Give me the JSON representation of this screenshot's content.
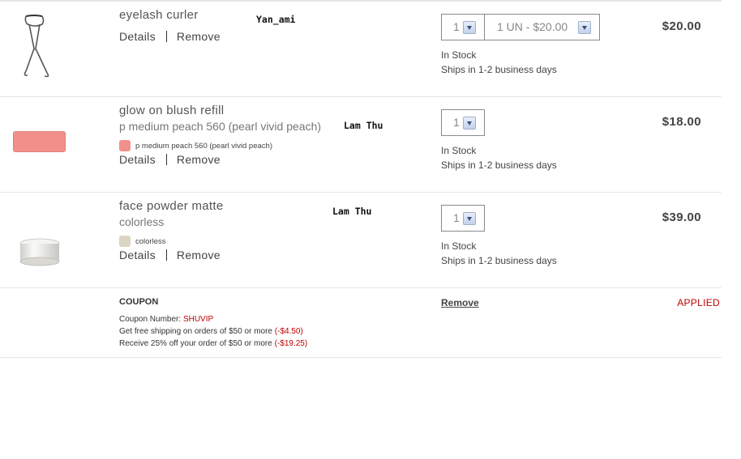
{
  "items": [
    {
      "name": "eyelash curler",
      "details_label": "Details",
      "remove_label": "Remove",
      "user_tag": "Yan_ami",
      "qty": "1",
      "variant": "1 UN - $20.00",
      "stock": "In Stock",
      "ships": "Ships in 1-2 business days",
      "price": "$20.00",
      "icon": "eyelash-curler-icon"
    },
    {
      "name": "glow on blush refill",
      "shade": "p medium peach 560 (pearl vivid peach)",
      "swatch_label": "p medium peach 560 (pearl vivid peach)",
      "swatch_color": "#f1908a",
      "details_label": "Details",
      "remove_label": "Remove",
      "user_tag": "Lam Thu",
      "qty": "1",
      "stock": "In Stock",
      "ships": "Ships in 1-2 business days",
      "price": "$18.00"
    },
    {
      "name": "face powder matte",
      "shade": "colorless",
      "swatch_label": "colorless",
      "swatch_color": "#ddd5c3",
      "details_label": "Details",
      "remove_label": "Remove",
      "user_tag": "Lam Thu",
      "qty": "1",
      "stock": "In Stock",
      "ships": "Ships in 1-2 business days",
      "price": "$39.00"
    }
  ],
  "coupon": {
    "title": "COUPON",
    "number_label": "Coupon Number:",
    "number": "SHUVIP",
    "line1_text": "Get free shipping on orders of $50 or more",
    "line1_amount": "(-$4.50)",
    "line2_text": "Receive 25% off your order of $50 or more",
    "line2_amount": "(-$19.25)",
    "remove_label": "Remove",
    "status": "APPLIED"
  },
  "colors": {
    "accent_red": "#c00000",
    "blush": "#f1908a",
    "divider": "#e6e6e6"
  }
}
